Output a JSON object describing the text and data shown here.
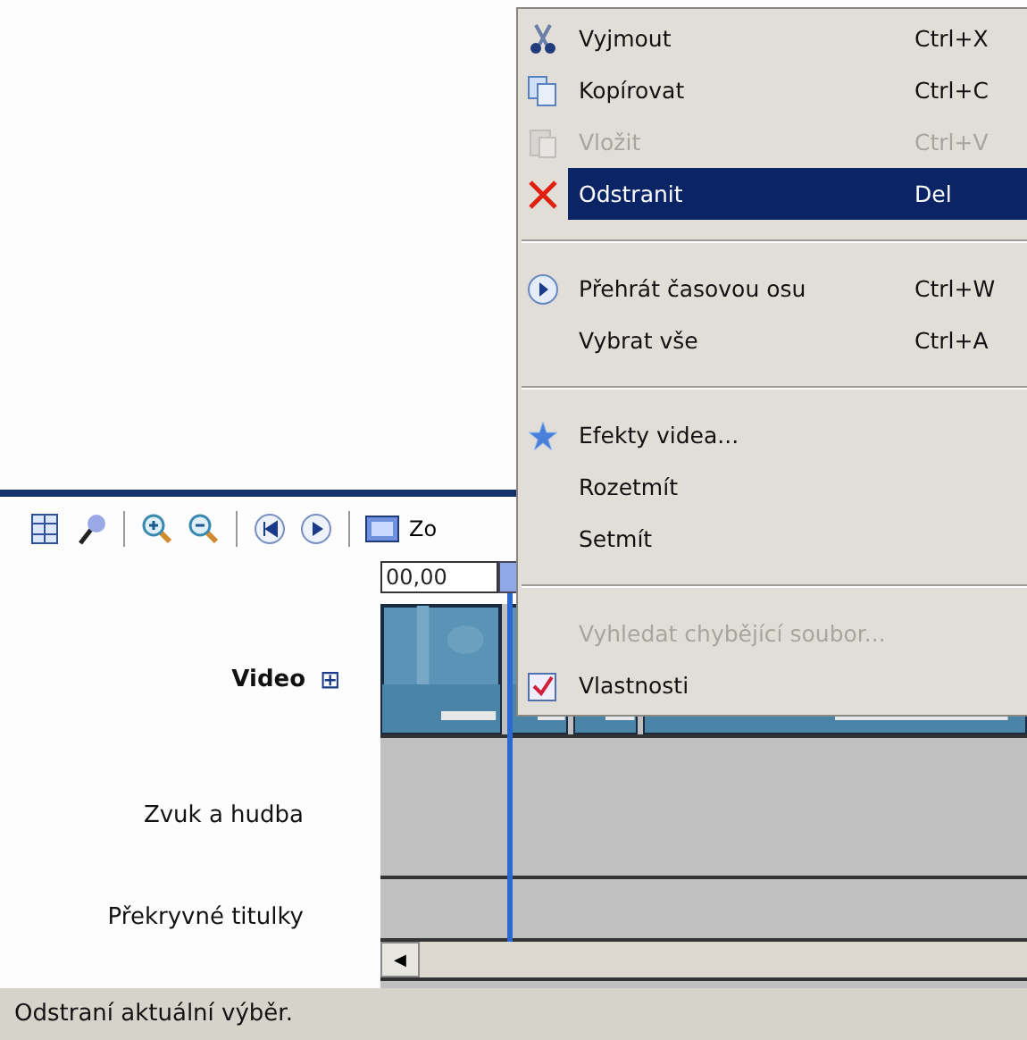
{
  "toolbar": {
    "zoom_label": "Zo"
  },
  "ruler": {
    "time": "00,00"
  },
  "tracks": [
    {
      "kind": "video",
      "label": "Video",
      "expand": "⊞"
    },
    {
      "kind": "empty",
      "label": "Zvuk a hudba"
    },
    {
      "kind": "empty",
      "label": "Překryvné titulky"
    }
  ],
  "scrollbar": {
    "left_arrow": "◀"
  },
  "context_menu": {
    "items": [
      {
        "kind": "item",
        "label": "Vyjmout",
        "shortcut": "Ctrl+X",
        "disabled": false,
        "selected": false
      },
      {
        "kind": "item",
        "label": "Kopírovat",
        "shortcut": "Ctrl+C",
        "disabled": false,
        "selected": false
      },
      {
        "kind": "item",
        "label": "Vložit",
        "shortcut": "Ctrl+V",
        "disabled": true,
        "selected": false
      },
      {
        "kind": "item",
        "label": "Odstranit",
        "shortcut": "Del",
        "disabled": false,
        "selected": true
      },
      {
        "kind": "separator"
      },
      {
        "kind": "item",
        "label": "Přehrát časovou osu",
        "shortcut": "Ctrl+W",
        "disabled": false,
        "selected": false
      },
      {
        "kind": "item",
        "label": "Vybrat vše",
        "shortcut": "Ctrl+A",
        "disabled": false,
        "selected": false
      },
      {
        "kind": "separator"
      },
      {
        "kind": "item",
        "label": "Efekty videa...",
        "disabled": false,
        "selected": false
      },
      {
        "kind": "item",
        "label": "Rozetmít",
        "disabled": false,
        "selected": false
      },
      {
        "kind": "item",
        "label": "Setmít",
        "disabled": false,
        "selected": false
      },
      {
        "kind": "separator"
      },
      {
        "kind": "item",
        "label": "Vyhledat chybějící soubor...",
        "disabled": true,
        "selected": false
      },
      {
        "kind": "item",
        "label": "Vlastnosti",
        "disabled": false,
        "selected": false
      }
    ]
  },
  "status_bar": {
    "text": "Odstraní aktuální výběr."
  }
}
